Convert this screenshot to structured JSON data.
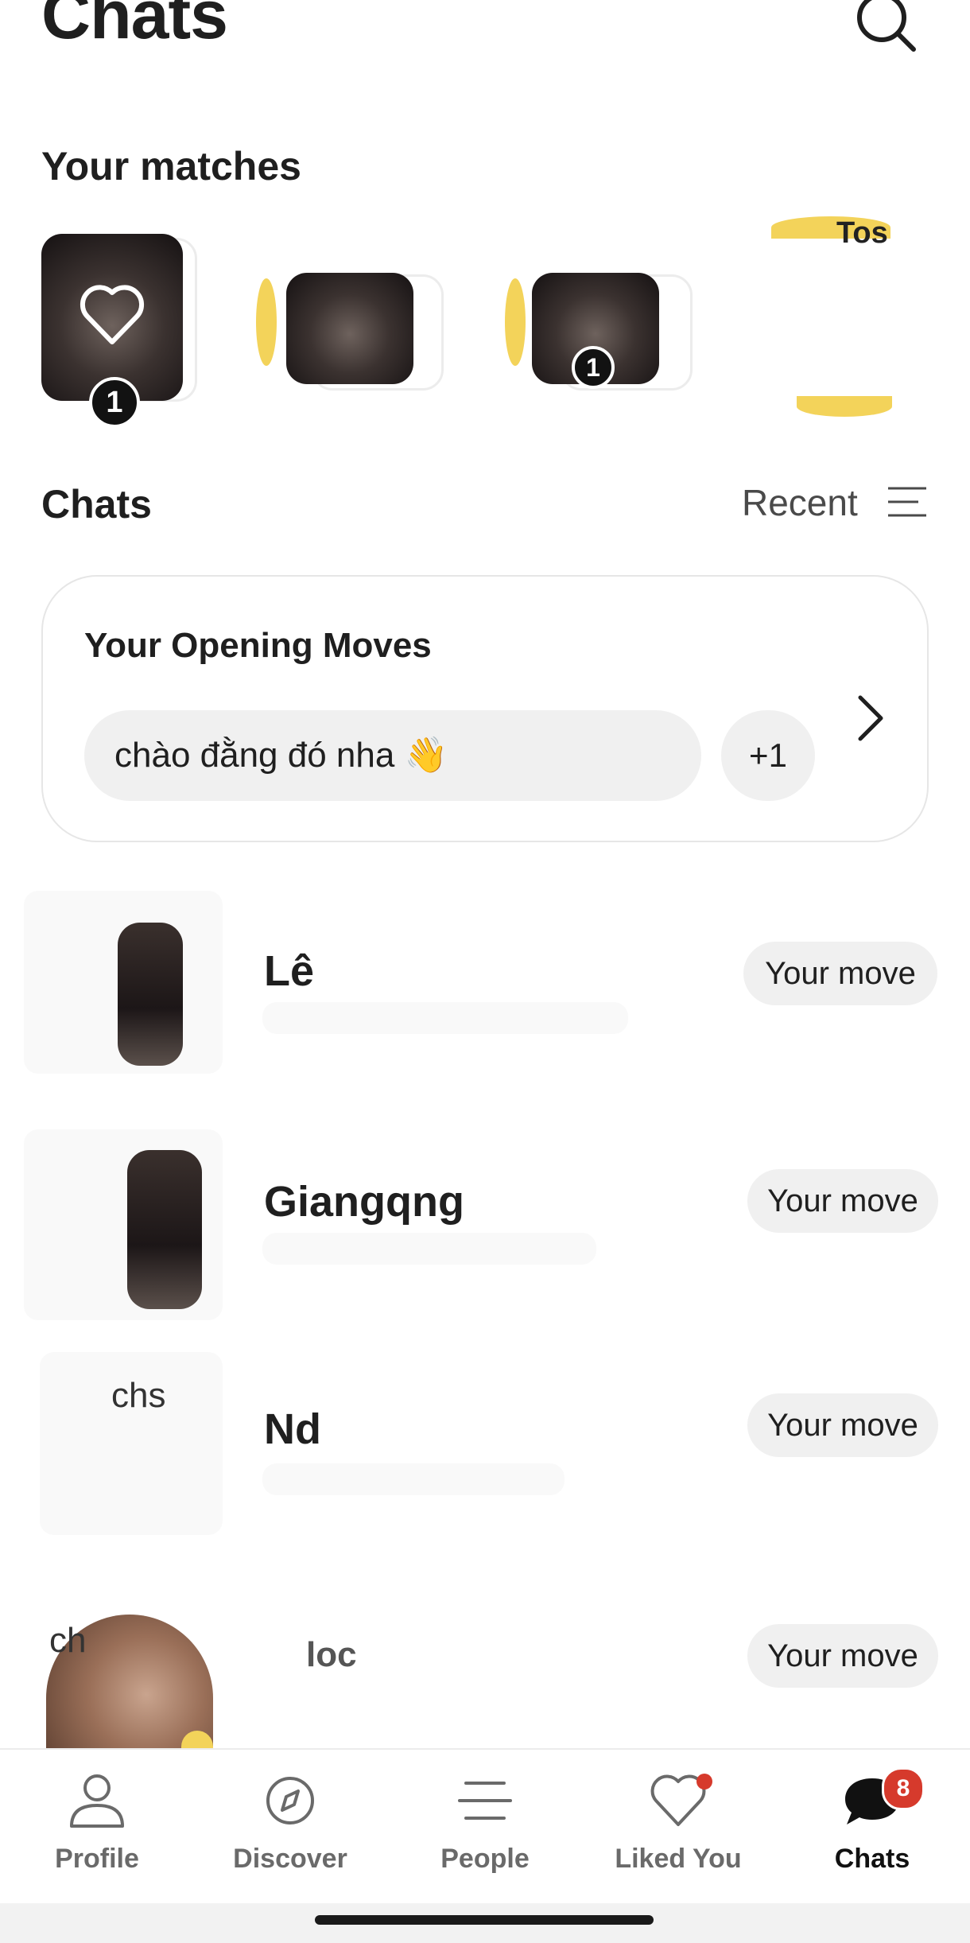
{
  "header": {
    "title": "Chats"
  },
  "matches": {
    "heading": "Your matches",
    "items": [
      {
        "badge": "1"
      },
      {
        "badge": ""
      },
      {
        "badge": "1"
      },
      {
        "label": "Tos"
      }
    ]
  },
  "chats_section": {
    "heading": "Chats",
    "sort_label": "Recent"
  },
  "opening_moves": {
    "title": "Your Opening Moves",
    "message": "chào đằng đó nha 👋",
    "more": "+1"
  },
  "chat_list": [
    {
      "name": "Lê",
      "status": "Your move"
    },
    {
      "name": "Giangqng",
      "status": "Your move"
    },
    {
      "name": "Nd",
      "avatar_text": "chs",
      "status": "Your move"
    },
    {
      "name": "loc",
      "avatar_text": "ch",
      "status": "Your move"
    }
  ],
  "bottom_nav": [
    {
      "label": "Profile",
      "icon": "person-icon"
    },
    {
      "label": "Discover",
      "icon": "compass-icon"
    },
    {
      "label": "People",
      "icon": "people-list-icon"
    },
    {
      "label": "Liked You",
      "icon": "heart-icon",
      "dot": true
    },
    {
      "label": "Chats",
      "icon": "chat-bubble-icon",
      "badge": "8",
      "active": true
    }
  ],
  "colors": {
    "badge_red": "#d63a2c",
    "accent_yellow": "#f3d35a",
    "pill_bg": "#f0f0f0"
  }
}
